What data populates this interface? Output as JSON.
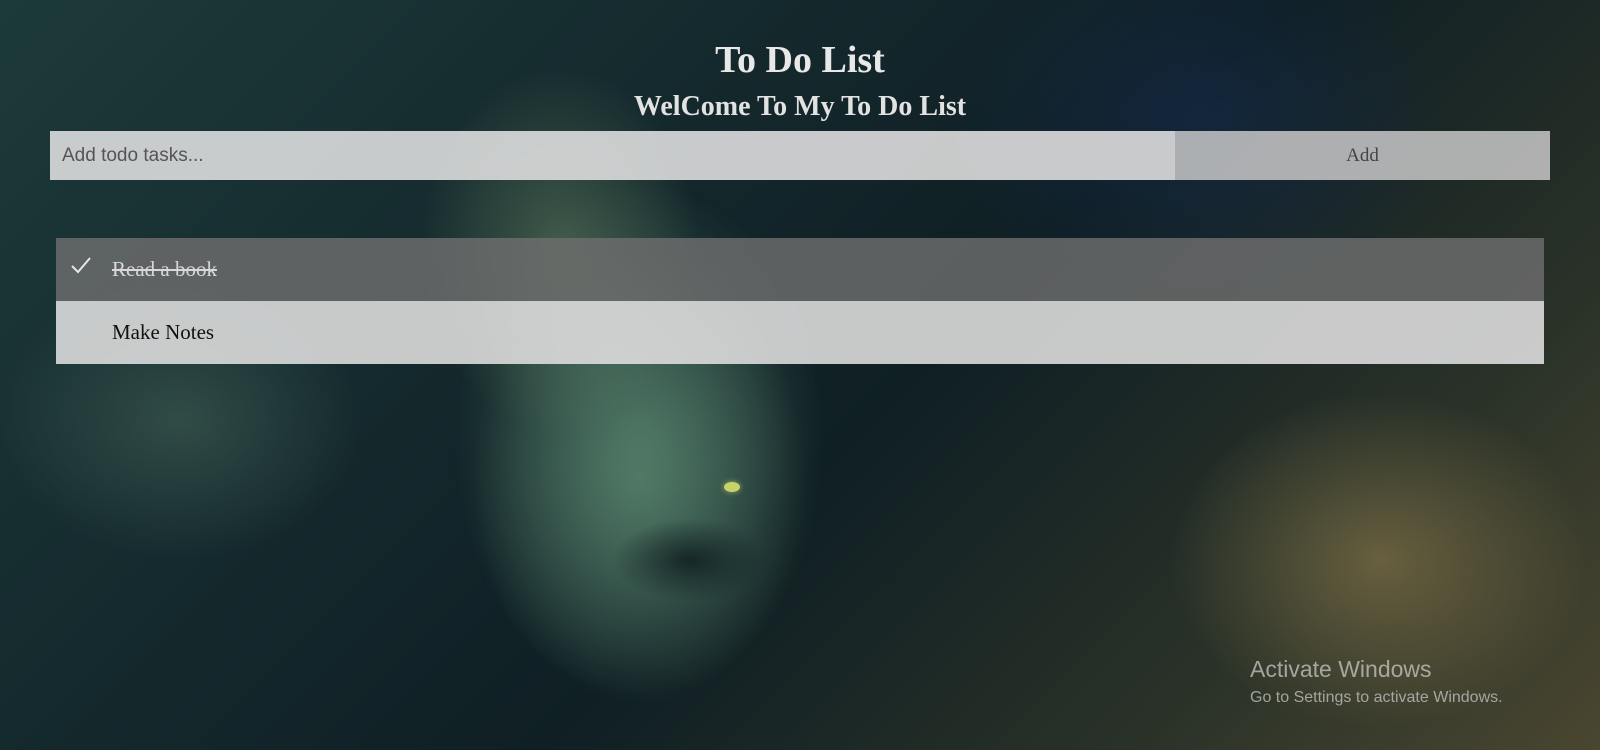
{
  "header": {
    "title": "To Do List",
    "subtitle": "WelCome To My To Do List"
  },
  "add_form": {
    "placeholder": "Add todo tasks...",
    "button_label": "Add"
  },
  "tasks": [
    {
      "label": "Read a book",
      "completed": true,
      "icon": "check-icon"
    },
    {
      "label": "Make Notes",
      "completed": false
    }
  ],
  "watermark": {
    "title": "Activate Windows",
    "text": "Go to Settings to activate Windows."
  },
  "colors": {
    "title_text": "#e8e8e8",
    "completed_row": "#6e6e6e",
    "pending_row": "#dcdcdc"
  }
}
